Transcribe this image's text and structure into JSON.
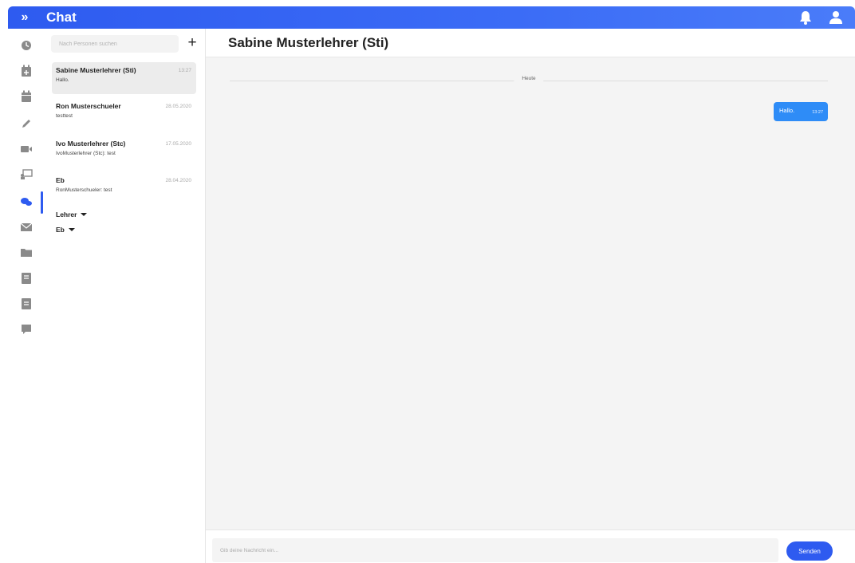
{
  "app": {
    "title": "Chat"
  },
  "colors": {
    "accent": "#2e5bf0",
    "bubble": "#2e8cf7",
    "icon_gray": "#8a8a8a"
  },
  "topbar": {
    "icons": [
      "bell-icon",
      "user-icon"
    ]
  },
  "rail": {
    "items": [
      {
        "name": "clock-icon"
      },
      {
        "name": "calendar-add-icon"
      },
      {
        "name": "calendar-icon"
      },
      {
        "name": "pencil-icon"
      },
      {
        "name": "video-icon"
      },
      {
        "name": "presentation-icon"
      },
      {
        "name": "chat-icon",
        "active": true
      },
      {
        "name": "mail-icon"
      },
      {
        "name": "folder-icon"
      },
      {
        "name": "notebook-icon"
      },
      {
        "name": "book-icon"
      },
      {
        "name": "comment-icon"
      }
    ]
  },
  "sidebar": {
    "search_placeholder": "Nach Personen suchen",
    "add_label": "+",
    "conversations": [
      {
        "name": "Sabine Musterlehrer (Sti)",
        "time": "13:27",
        "preview": "Hallo."
      },
      {
        "name": "Ron Musterschueler",
        "time": "28.05.2020",
        "preview": "testtest"
      },
      {
        "name": "Ivo Musterlehrer (Stc)",
        "time": "17.05.2020",
        "preview": "IvoMusterlehrer (Stc): test"
      },
      {
        "name": "Eb",
        "time": "28.04.2020",
        "preview": "RonMusterschueler: test"
      }
    ],
    "groups": [
      {
        "label": "Lehrer"
      },
      {
        "label": "Eb"
      }
    ]
  },
  "chat": {
    "title": "Sabine Musterlehrer (Sti)",
    "day_label": "Heute",
    "messages": [
      {
        "text": "Hallo.",
        "time": "13:27"
      }
    ],
    "input_placeholder": "Gib deine Nachricht ein...",
    "send_label": "Senden"
  }
}
